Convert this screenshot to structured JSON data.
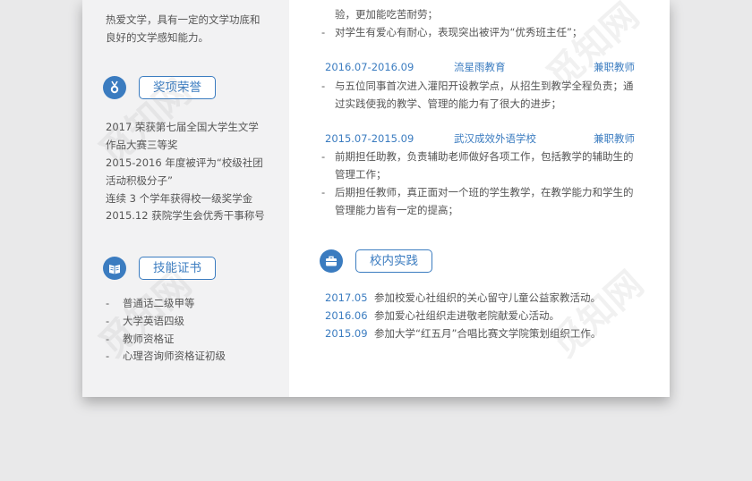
{
  "sidebar": {
    "intro_lines": [
      "热爱文学，具有一定的文学功底和",
      "良好的文学感知能力。"
    ],
    "awards": {
      "title": "奖项荣誉",
      "icon": "medal-icon",
      "lines": [
        "2017  荣获第七届全国大学生文学",
        "作品大赛三等奖",
        "2015-2016 年度被评为“校级社团",
        "活动积极分子”",
        "连续 3 个学年获得校一级奖学金",
        "2015.12 获院学生会优秀干事称号"
      ]
    },
    "skills": {
      "title": "技能证书",
      "icon": "book-icon",
      "items": [
        "普通话二级甲等",
        "大学英语四级",
        "教师资格证",
        "心理咨询师资格证初级"
      ]
    }
  },
  "main": {
    "top_lines": [
      "验，更加能吃苦耐劳；"
    ],
    "top_bullet": "对学生有爱心有耐心，表现突出被评为“优秀班主任”；",
    "jobs": [
      {
        "date": "2016.07-2016.09",
        "org": "流星雨教育",
        "role": "兼职教师",
        "bullets": [
          [
            "与五位同事首次进入灌阳开设教学点，从招生到教学全程负责；通",
            "过实践使我的教学、管理的能力有了很大的进步；"
          ]
        ]
      },
      {
        "date": "2015.07-2015.09",
        "org": "武汉成效外语学校",
        "role": "兼职教师",
        "bullets": [
          [
            "前期担任助教，负责辅助老师做好各项工作，包括教学的辅助生的",
            "管理工作；"
          ],
          [
            "后期担任教师，真正面对一个班的学生教学，在教学能力和学生的",
            "管理能力皆有一定的提高；"
          ]
        ]
      }
    ],
    "practice": {
      "title": "校内实践",
      "icon": "briefcase-icon",
      "items": [
        {
          "date": "2017.05",
          "text": "参加校爱心社组织的关心留守儿童公益家教活动。"
        },
        {
          "date": "2016.06",
          "text": "参加爱心社组织走进敬老院献爱心活动。"
        },
        {
          "date": "2015.09",
          "text": "参加大学“红五月”合唱比赛文学院策划组织工作。"
        }
      ]
    }
  },
  "watermark": "觅知网",
  "colors": {
    "accent": "#3b7cc0",
    "sidebar_bg": "#f2f2f3",
    "page_bg": "#e9e9ea"
  }
}
